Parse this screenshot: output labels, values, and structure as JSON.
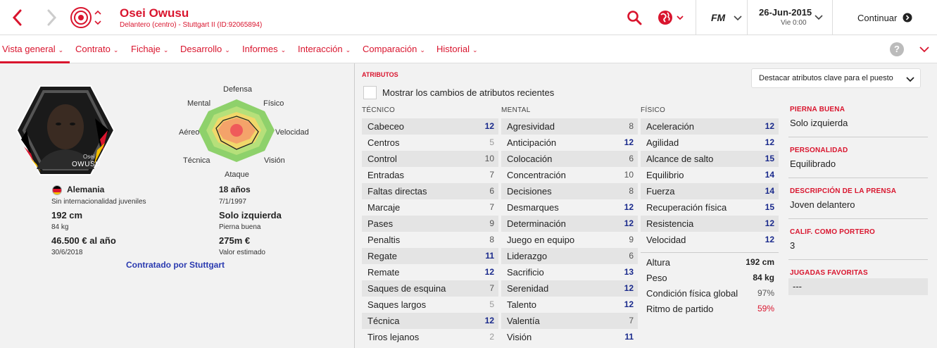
{
  "header": {
    "player_name": "Osei Owusu",
    "player_subtitle": "Delantero (centro) - Stuttgart II (ID:92065894)",
    "fm_label": "FM",
    "date": "26-Jun-2015",
    "day_time": "Vie 0:00",
    "continue_label": "Continuar"
  },
  "tabs": [
    {
      "label": "Vista general"
    },
    {
      "label": "Contrato"
    },
    {
      "label": "Fichaje"
    },
    {
      "label": "Desarrollo"
    },
    {
      "label": "Informes"
    },
    {
      "label": "Interacción"
    },
    {
      "label": "Comparación"
    },
    {
      "label": "Historial"
    }
  ],
  "profile": {
    "badge_name_small": "Osei",
    "badge_name_big": "OWUSU",
    "nation": "Alemania",
    "intl_caps": "Sin internacionalidad juveniles",
    "height": "192 cm",
    "weight": "84 kg",
    "wage": "46.500 € al año",
    "contract_end": "30/6/2018",
    "age": "18 años",
    "dob": "7/1/1997",
    "foot": "Solo izquierda",
    "foot_label": "Pierna buena",
    "value": "275m €",
    "value_label": "Valor estimado",
    "signed_by": "Contratado por Stuttgart"
  },
  "radar": {
    "labels": {
      "top": "Defensa",
      "top_left": "Mental",
      "top_right": "Físico",
      "left": "Aéreo",
      "right": "Velocidad",
      "bottom_left": "Técnica",
      "bottom_right": "Visión",
      "bottom": "Ataque"
    }
  },
  "attributes": {
    "section_title": "ATRIBUTOS",
    "highlight_dropdown": "Destacar atributos clave para el puesto",
    "show_changes_label": "Mostrar los cambios de atributos recientes",
    "technical_header": "TÉCNICO",
    "mental_header": "MENTAL",
    "physical_header": "FÍSICO",
    "technical": [
      {
        "name": "Cabeceo",
        "value": "12"
      },
      {
        "name": "Centros",
        "value": "5"
      },
      {
        "name": "Control",
        "value": "10"
      },
      {
        "name": "Entradas",
        "value": "7"
      },
      {
        "name": "Faltas directas",
        "value": "6"
      },
      {
        "name": "Marcaje",
        "value": "7"
      },
      {
        "name": "Pases",
        "value": "9"
      },
      {
        "name": "Penaltis",
        "value": "8"
      },
      {
        "name": "Regate",
        "value": "11"
      },
      {
        "name": "Remate",
        "value": "12"
      },
      {
        "name": "Saques de esquina",
        "value": "7"
      },
      {
        "name": "Saques largos",
        "value": "5"
      },
      {
        "name": "Técnica",
        "value": "12"
      },
      {
        "name": "Tiros lejanos",
        "value": "2"
      }
    ],
    "mental": [
      {
        "name": "Agresividad",
        "value": "8"
      },
      {
        "name": "Anticipación",
        "value": "12"
      },
      {
        "name": "Colocación",
        "value": "6"
      },
      {
        "name": "Concentración",
        "value": "10"
      },
      {
        "name": "Decisiones",
        "value": "8"
      },
      {
        "name": "Desmarques",
        "value": "12"
      },
      {
        "name": "Determinación",
        "value": "12"
      },
      {
        "name": "Juego en equipo",
        "value": "9"
      },
      {
        "name": "Liderazgo",
        "value": "6"
      },
      {
        "name": "Sacrificio",
        "value": "13"
      },
      {
        "name": "Serenidad",
        "value": "12"
      },
      {
        "name": "Talento",
        "value": "12"
      },
      {
        "name": "Valentía",
        "value": "7"
      },
      {
        "name": "Visión",
        "value": "11"
      }
    ],
    "physical": [
      {
        "name": "Aceleración",
        "value": "12"
      },
      {
        "name": "Agilidad",
        "value": "12"
      },
      {
        "name": "Alcance de salto",
        "value": "15"
      },
      {
        "name": "Equilibrio",
        "value": "14"
      },
      {
        "name": "Fuerza",
        "value": "14"
      },
      {
        "name": "Recuperación física",
        "value": "15"
      },
      {
        "name": "Resistencia",
        "value": "12"
      },
      {
        "name": "Velocidad",
        "value": "12"
      }
    ],
    "physical_extra": [
      {
        "name": "Altura",
        "value": "192 cm"
      },
      {
        "name": "Peso",
        "value": "84 kg"
      },
      {
        "name": "Condición física global",
        "value": "97%"
      },
      {
        "name": "Ritmo de partido",
        "value": "59%"
      }
    ]
  },
  "info_panel": [
    {
      "label": "PIERNA BUENA",
      "value": "Solo izquierda"
    },
    {
      "label": "PERSONALIDAD",
      "value": "Equilibrado"
    },
    {
      "label": "DESCRIPCIÓN DE LA PRENSA",
      "value": "Joven delantero"
    },
    {
      "label": "CALIF. COMO PORTERO",
      "value": "3"
    },
    {
      "label": "JUGADAS FAVORITAS",
      "value": "---"
    }
  ],
  "colors": {
    "accent": "#d9152e",
    "high_value": "#1a2a8c",
    "match_rhythm": "#d9152e"
  }
}
